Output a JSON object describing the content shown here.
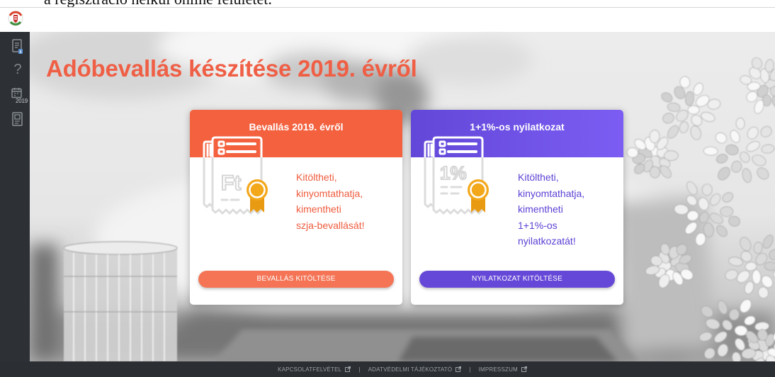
{
  "top_banner_text": "a regisztráció nélkül online felületét.",
  "logo": {
    "icon": "nav-logo-icon"
  },
  "sidebar": {
    "items": [
      {
        "icon": "document-info-icon"
      },
      {
        "icon": "help-icon",
        "glyph": "?"
      },
      {
        "icon": "calendar-icon",
        "label": "2019"
      },
      {
        "icon": "form-icon"
      }
    ]
  },
  "page": {
    "title": "Adóbevallás készítése 2019. évről"
  },
  "cards": [
    {
      "title": "Bevallás 2019. évről",
      "icon": "tax-return-document-icon",
      "icon_text": "Ft",
      "lines": [
        "Kitöltheti,",
        "kinyomtathatja,",
        "kimentheti",
        "szja-bevallását!"
      ],
      "button": "BEVALLÁS KITÖLTÉSE"
    },
    {
      "title": "1+1%-os nyilatkozat",
      "icon": "percent-declaration-document-icon",
      "icon_text": "1%",
      "lines": [
        "Kitöltheti,",
        "kinyomtathatja,",
        "kimentheti",
        "1+1%-os",
        "nyilatkozatát!"
      ],
      "button": "NYILATKOZAT KITÖLTÉSE"
    }
  ],
  "footer": {
    "links": [
      {
        "label": "KAPCSOLATFELVÉTEL",
        "icon": "external-link-icon"
      },
      {
        "label": "ADATVÉDELMI TÁJÉKOZTATÓ",
        "icon": "external-link-icon"
      },
      {
        "label": "IMPRESSZUM",
        "icon": "external-link-icon"
      }
    ],
    "separator": "|"
  },
  "colors": {
    "title_orange": "#ef5f45",
    "card_orange": "#f3613f",
    "card_purple_start": "#6247d8",
    "card_purple_end": "#7c5df3",
    "card_text_orange": "#ee5b3d",
    "card_text_purple": "#5d41d4",
    "button_orange": "#f47455",
    "button_purple": "#6648d8",
    "medal_gold": "#f3a81c",
    "medal_ribbon": "#e89a12",
    "sidebar_bg": "#2d3135",
    "footer_bg": "#2b2e32",
    "footer_text": "#9aa1a7"
  }
}
